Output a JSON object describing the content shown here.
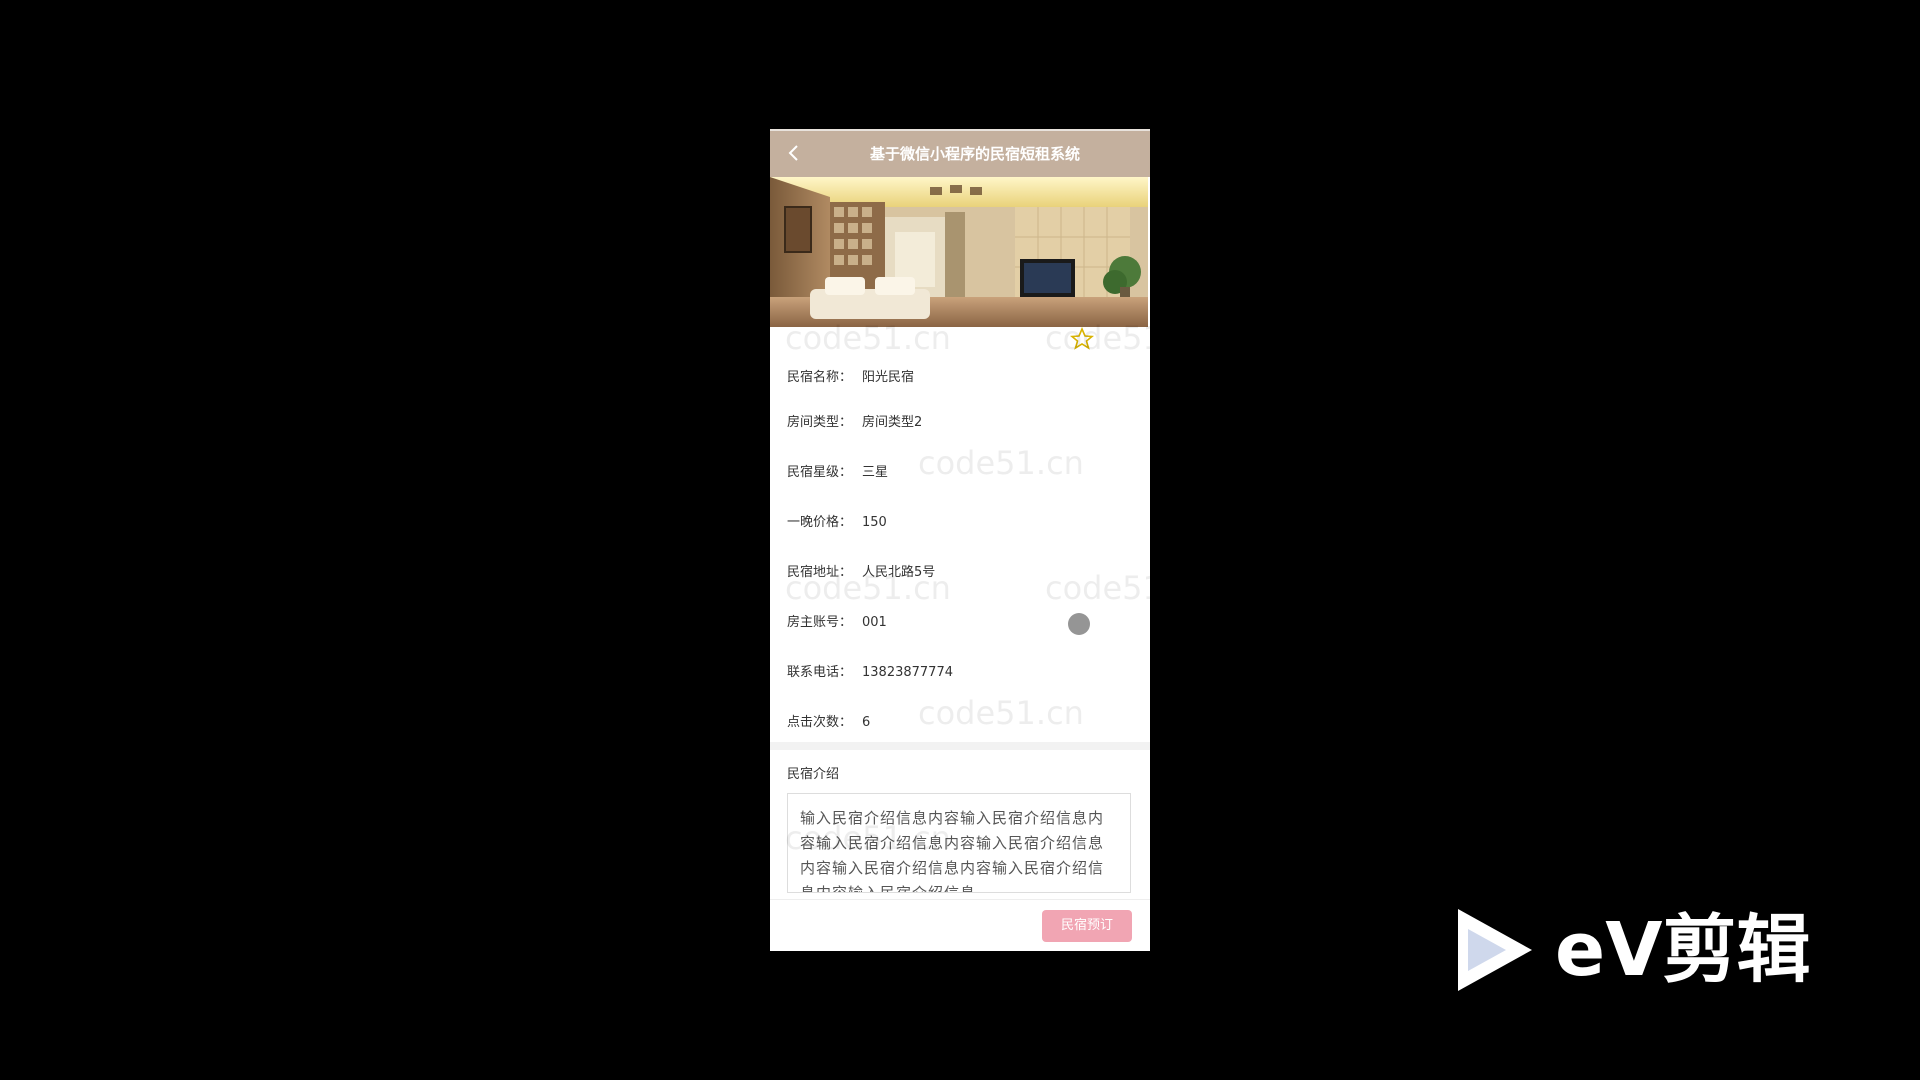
{
  "header": {
    "title": "基于微信小程序的民宿短租系统"
  },
  "details": [
    {
      "label": "民宿名称：",
      "value": "阳光民宿"
    },
    {
      "label": "房间类型：",
      "value": "房间类型2"
    },
    {
      "label": "民宿星级：",
      "value": "三星"
    },
    {
      "label": "一晚价格：",
      "value": "150"
    },
    {
      "label": "民宿地址：",
      "value": "人民北路5号"
    },
    {
      "label": "房主账号：",
      "value": "001"
    },
    {
      "label": "联系电话：",
      "value": "13823877774"
    },
    {
      "label": "点击次数：",
      "value": "6"
    }
  ],
  "intro": {
    "title": "民宿介绍",
    "content": "输入民宿介绍信息内容输入民宿介绍信息内容输入民宿介绍信息内容输入民宿介绍信息内容输入民宿介绍信息内容输入民宿介绍信息内容输入民宿介绍信息"
  },
  "actions": {
    "book_label": "民宿预订"
  },
  "watermark": {
    "text": "code51.cn"
  },
  "branding": {
    "player_logo_text": "eV剪辑"
  },
  "colors": {
    "header_bg": "#c4b09e",
    "button_bg": "#f1a5b3",
    "star": "#d9b300"
  },
  "icons": {
    "back": "back-chevron-icon",
    "favorite": "star-outline-icon",
    "player_logo": "play-triangle-icon"
  }
}
